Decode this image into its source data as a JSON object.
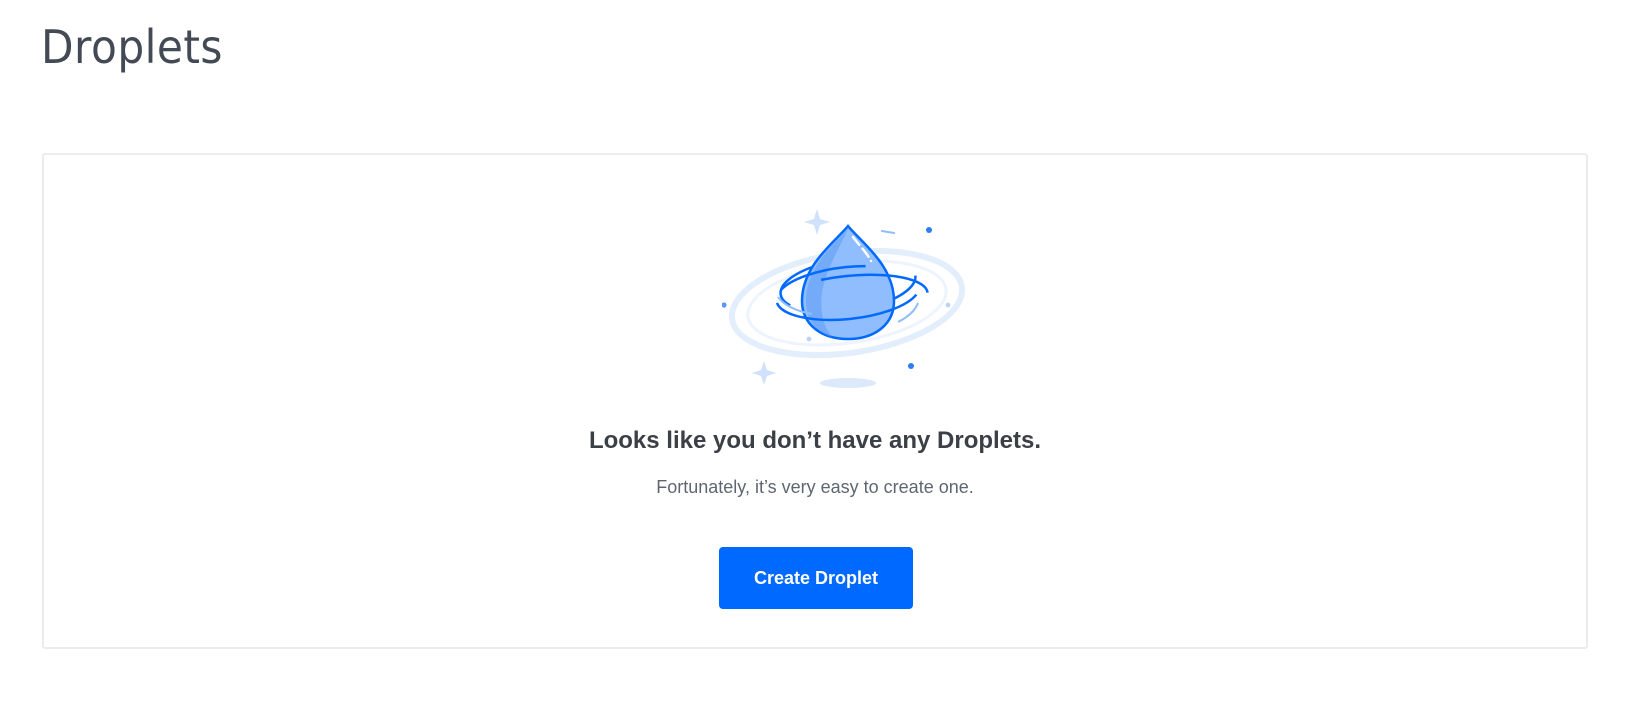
{
  "header": {
    "title": "Droplets"
  },
  "empty_state": {
    "illustration_icon": "droplet-icon",
    "heading": "Looks like you don’t have any Droplets.",
    "subheading": "Fortunately, it’s very easy to create one.",
    "button_label": "Create Droplet"
  },
  "colors": {
    "accent": "#0069ff",
    "droplet_fill": "#8fbdfd",
    "droplet_stroke": "#0069ff",
    "ring_light": "#dbe9fb"
  }
}
